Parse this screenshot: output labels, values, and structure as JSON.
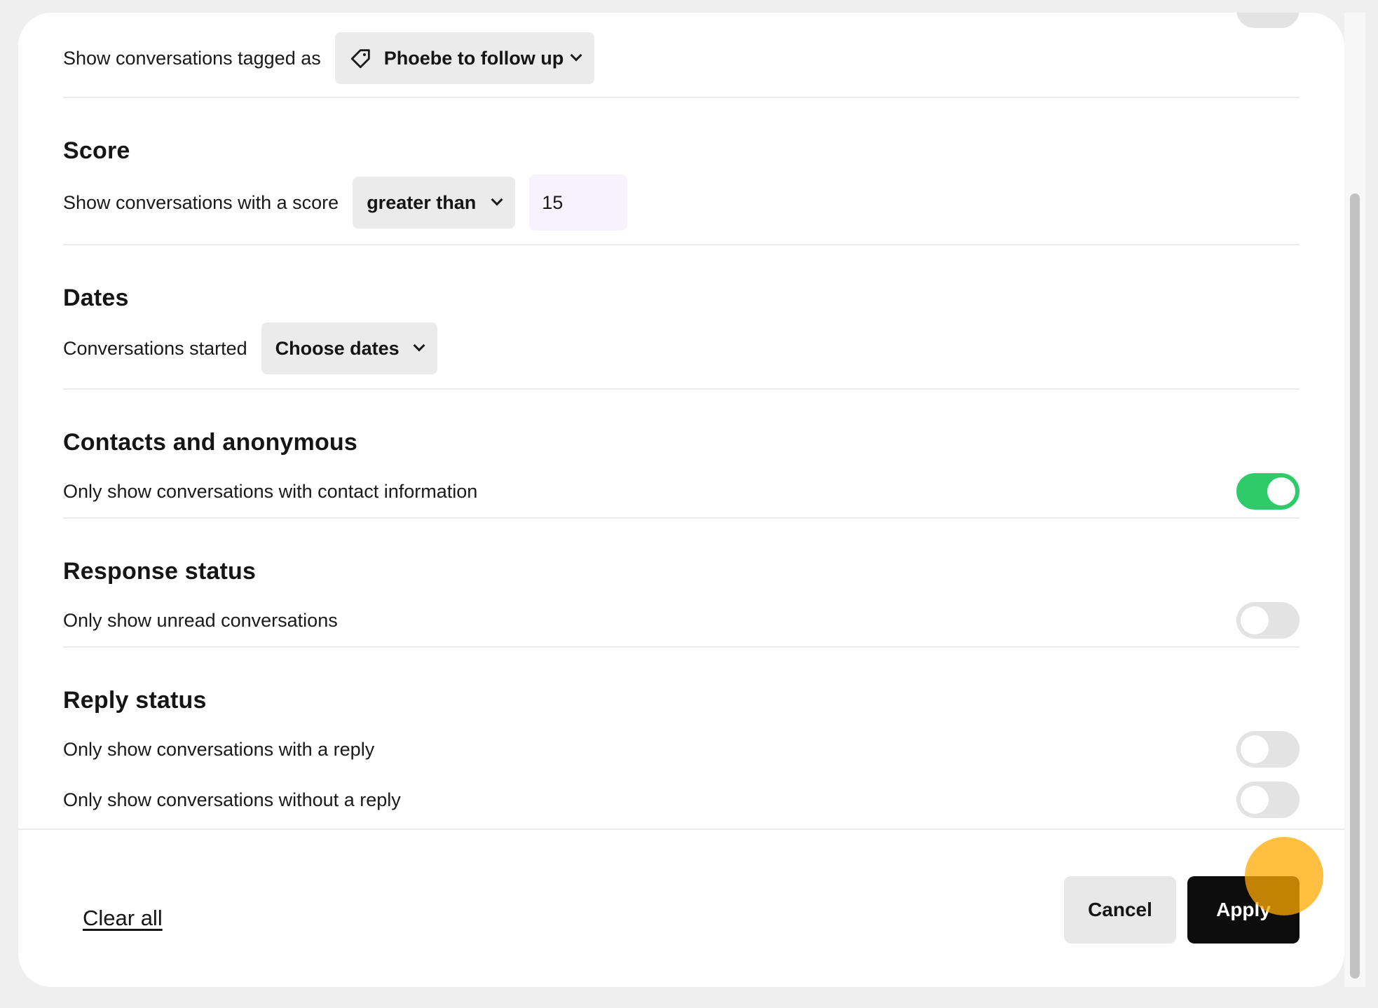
{
  "tags": {
    "label": "Show conversations tagged as",
    "selected": "Phoebe to follow up"
  },
  "score": {
    "title": "Score",
    "label": "Show conversations with a score",
    "operator": "greater than",
    "value": "15"
  },
  "dates": {
    "title": "Dates",
    "label": "Conversations started",
    "selected": "Choose dates"
  },
  "contacts": {
    "title": "Contacts and anonymous",
    "label": "Only show conversations with contact information",
    "enabled": true
  },
  "response_status": {
    "title": "Response status",
    "label": "Only show unread conversations",
    "enabled": false
  },
  "reply_status": {
    "title": "Reply status",
    "with_reply_label": "Only show conversations with a reply",
    "with_reply_enabled": false,
    "without_reply_label": "Only show conversations without a reply",
    "without_reply_enabled": false
  },
  "footer": {
    "clear_all": "Clear all",
    "cancel": "Cancel",
    "apply": "Apply"
  },
  "colors": {
    "toggle_on": "#2fcb6b",
    "apply_button": "#0d0d0d",
    "cursor_highlight": "#ffaa00"
  }
}
